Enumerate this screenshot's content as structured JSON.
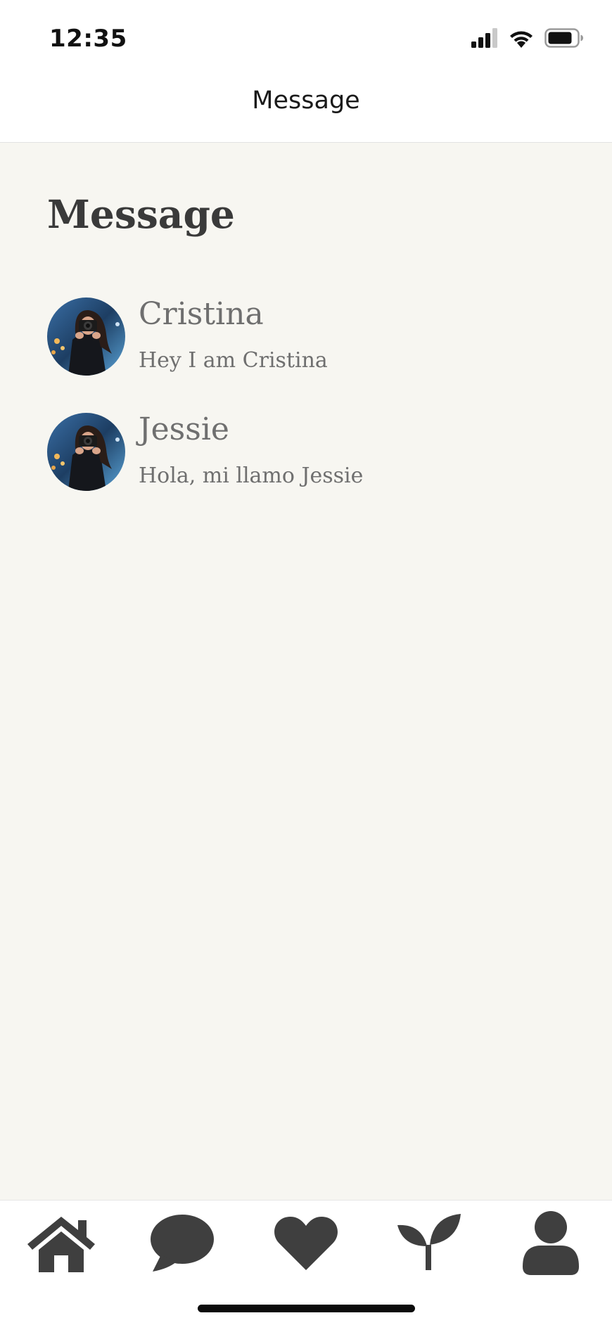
{
  "status_bar": {
    "time": "12:35",
    "icons": [
      "signal-icon",
      "wifi-icon",
      "battery-icon"
    ]
  },
  "nav": {
    "title": "Message"
  },
  "page": {
    "title": "Message"
  },
  "conversations": [
    {
      "name": "Cristina",
      "preview": "Hey I am Cristina",
      "avatar": "profile-photo"
    },
    {
      "name": "Jessie",
      "preview": "Hola, mi llamo Jessie",
      "avatar": "profile-photo"
    }
  ],
  "tab_bar": {
    "tabs": [
      {
        "icon": "home-icon"
      },
      {
        "icon": "chat-icon"
      },
      {
        "icon": "heart-icon"
      },
      {
        "icon": "sprout-icon"
      },
      {
        "icon": "person-icon"
      }
    ]
  },
  "colors": {
    "background": "#f7f6f1",
    "bars": "#ffffff",
    "text_dark": "#3a3a3a",
    "text_muted": "#6f6f6f",
    "icon": "#3f3f3f"
  }
}
